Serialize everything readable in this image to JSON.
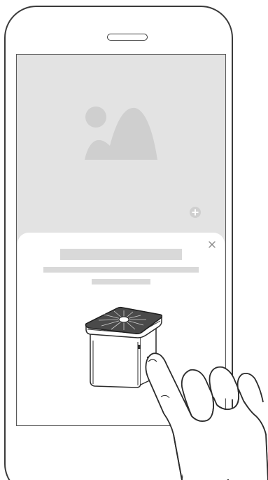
{
  "illustration": {
    "type": "phone-tutorial",
    "icons": [
      "image-placeholder-icon",
      "add-icon",
      "close-icon",
      "air-purifier-device",
      "pointing-hand"
    ]
  },
  "colors": {
    "frame": "#3a3a3a",
    "screen_background": "#e3e3e3",
    "placeholder_shape": "#cfcfcf",
    "card_background": "#ffffff",
    "skeleton_bar": "#d9d9d9"
  }
}
